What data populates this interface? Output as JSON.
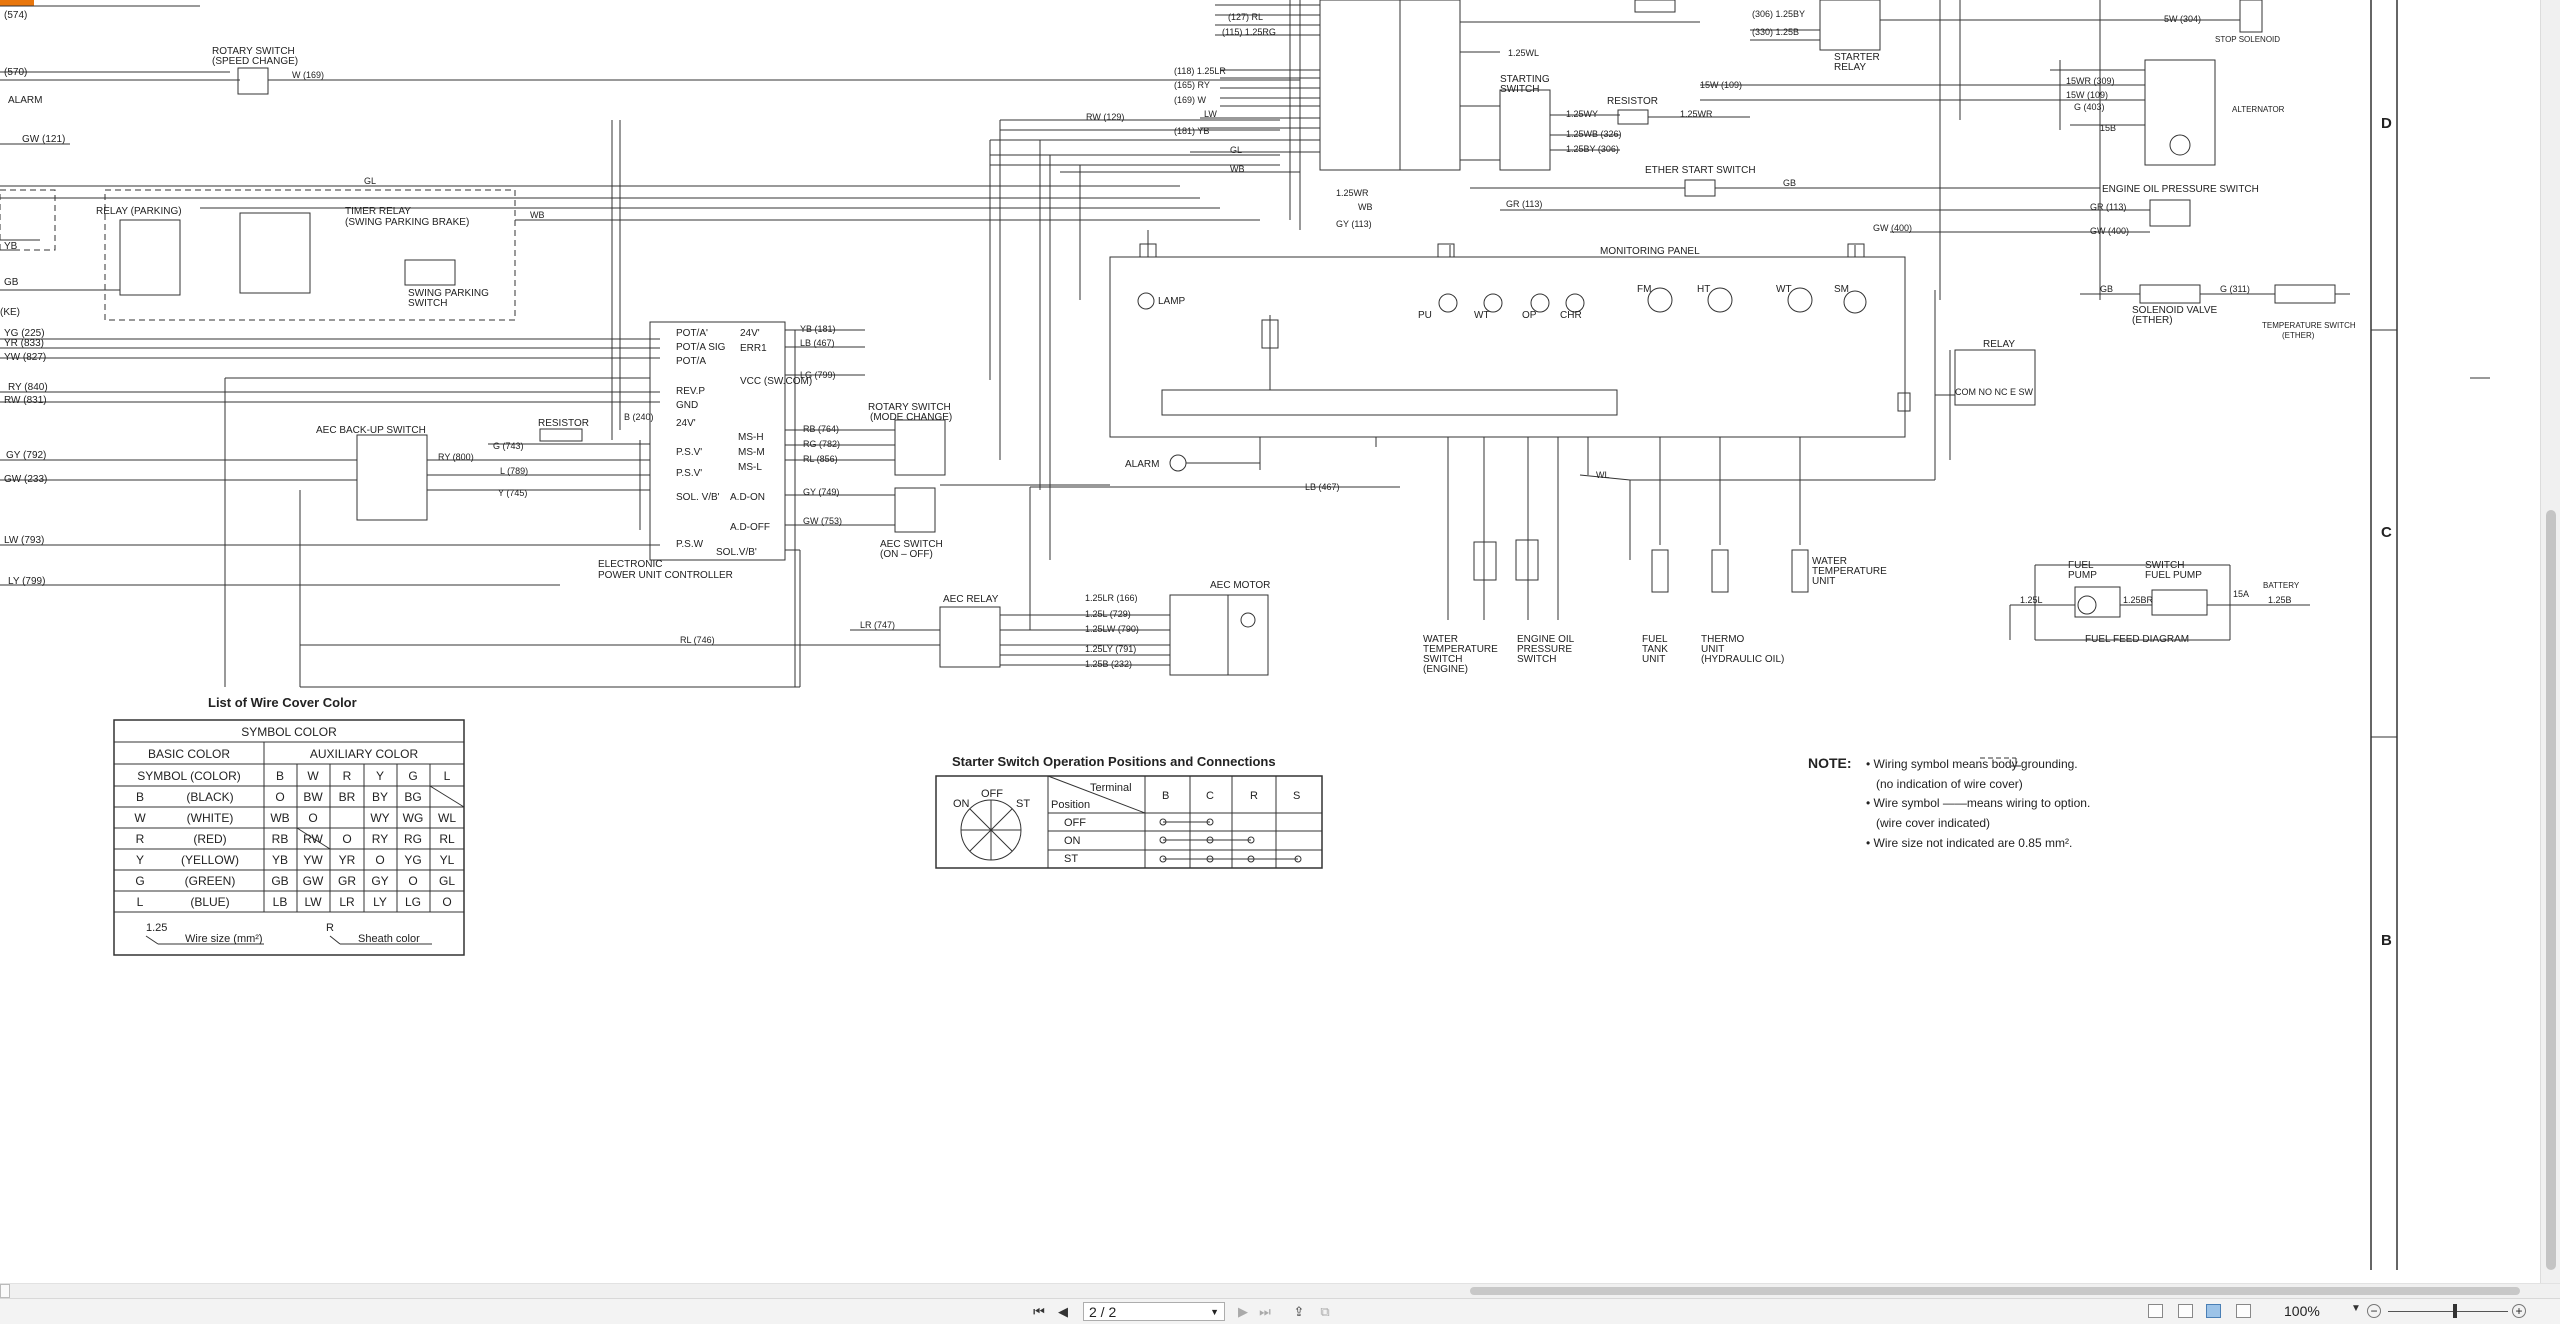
{
  "document": {
    "grid_labels": [
      "D",
      "C",
      "B"
    ],
    "components": {
      "rotary_switch_speed": [
        "ROTARY SWITCH",
        "(SPEED CHANGE)"
      ],
      "alarm": "ALARM",
      "relay_parking": "RELAY (PARKING)",
      "timer_relay": [
        "TIMER RELAY",
        "(SWING PARKING BRAKE)"
      ],
      "swing_parking_switch": [
        "SWING PARKING",
        "SWITCH"
      ],
      "starting_switch": [
        "STARTING",
        "SWITCH"
      ],
      "resistor_top": "RESISTOR",
      "starter_relay": [
        "STARTER",
        "RELAY"
      ],
      "stop_solenoid": "STOP SOLENOID",
      "alternator": "ALTERNATOR",
      "ether_start_switch": "ETHER START SWITCH",
      "engine_oil_pressure_switch": "ENGINE OIL PRESSURE SWITCH",
      "monitoring_panel": "MONITORING PANEL",
      "lamp": "LAMP",
      "solenoid_valve": [
        "SOLENOID VALVE",
        "(ETHER)"
      ],
      "temperature_switch": [
        "TEMPERATURE SWITCH",
        "(ETHER)"
      ],
      "relay_right": "RELAY",
      "relay_terms": "COM NO NC E SW",
      "aec_backup_switch": "AEC BACK-UP SWITCH",
      "resistor_mid": "RESISTOR",
      "controller": [
        "ELECTRONIC",
        "POWER UNIT CONTROLLER"
      ],
      "rotary_switch_mode": [
        "ROTARY SWITCH",
        "(MODE CHANGE)"
      ],
      "aec_switch": [
        "AEC SWITCH",
        "(ON – OFF)"
      ],
      "aec_relay": "AEC RELAY",
      "aec_motor": "AEC MOTOR",
      "alarm_mid": "ALARM",
      "water_temp_switch": [
        "WATER",
        "TEMPERATURE",
        "SWITCH",
        "(ENGINE)"
      ],
      "engine_oil_pressure_sw2": [
        "ENGINE OIL",
        "PRESSURE",
        "SWITCH"
      ],
      "fuel_tank_unit": [
        "FUEL",
        "TANK",
        "UNIT"
      ],
      "thermo_unit": [
        "THERMO",
        "UNIT",
        "(HYDRAULIC OIL)"
      ],
      "water_temp_unit": [
        "WATER",
        "TEMPERATURE",
        "UNIT"
      ],
      "fuel_pump": [
        "FUEL",
        "PUMP"
      ],
      "switch_fuel_pump": [
        "SWITCH",
        "FUEL PUMP"
      ],
      "battery": "BATTERY",
      "fuel_feed_diagram": "FUEL FEED DIAGRAM"
    },
    "controller_pins_left": [
      "POT/A'",
      "POT/A SIG",
      "POT/A",
      "REV.P",
      "GND",
      "24V'",
      "P.S.V'",
      "P.S.V'",
      "SOL. V/B'",
      "P.S.W"
    ],
    "controller_pins_right": [
      "24V'",
      "ERR1",
      "VCC (SW.COM)",
      "MS-H",
      "MS-M",
      "MS-L",
      "A.D-ON",
      "A.D-OFF",
      "SOL.V/B'"
    ],
    "monitor_gauges": [
      "PU",
      "WT",
      "OP",
      "CHR",
      "FM",
      "HT",
      "WT",
      "SM"
    ],
    "wire_labels_left": [
      "(574)",
      "(570)",
      "GW (121)",
      "YB",
      "GB",
      "(KE)",
      "YG (225)",
      "YR (833)",
      "YW (827)",
      "RY (840)",
      "RW (831)",
      "GY (792)",
      "GW (233)",
      "LW (793)",
      "LY (799)"
    ],
    "wire_labels_misc": [
      "W (169)",
      "GL",
      "WB",
      "RW (129)",
      "LW",
      "GL",
      "WB",
      "(181) YB",
      "(165) RY",
      "(169) W",
      "(118) 1.25LR",
      "(127) RL",
      "(115) 1.25RG",
      "1.25WL",
      "1.25WR",
      "1.25WB (326)",
      "1.25BY (306)",
      "1.25WY",
      "GB",
      "GR (113)",
      "GW (400)",
      "GY (113)",
      "1.25WR",
      "WB",
      "RY (800)",
      "L (789)",
      "Y (745)",
      "G (743)",
      "B (240)",
      "YB (181)",
      "LB (467)",
      "LG (799)",
      "RB (764)",
      "RG (782)",
      "RL (856)",
      "GY (749)",
      "GW (753)",
      "LR (747)",
      "RL (746)",
      "LB (467)",
      "WL",
      "1.25LR (166)",
      "1.25L (729)",
      "1.25LW (790)",
      "1.25LY (791)",
      "1.25B (232)",
      "15W (109)",
      "5W (304)",
      "15WR (309)",
      "15W (109)",
      "G (403)",
      "15B",
      "GR (113)",
      "GW (400)",
      "G (311)",
      "GB",
      "1.25L",
      "1.25BR",
      "15A",
      "1.25B",
      "(306) 1.25BY",
      "(330) 1.25B"
    ],
    "wire_cover": {
      "title": "List of Wire Cover Color",
      "symbol_color": "SYMBOL  COLOR",
      "basic_color": "BASIC  COLOR",
      "auxiliary_color": "AUXILIARY  COLOR",
      "header_row": [
        "SYMBOL  (COLOR)",
        "B",
        "W",
        "R",
        "Y",
        "G",
        "L"
      ],
      "rows": [
        [
          "B",
          "(BLACK)",
          "O",
          "BW",
          "BR",
          "BY",
          "BG",
          ""
        ],
        [
          "W",
          "(WHITE)",
          "WB",
          "O",
          "",
          "WY",
          "WG",
          "WL"
        ],
        [
          "R",
          "(RED)",
          "RB",
          "RW",
          "O",
          "RY",
          "RG",
          "RL"
        ],
        [
          "Y",
          "(YELLOW)",
          "YB",
          "YW",
          "YR",
          "O",
          "YG",
          "YL"
        ],
        [
          "G",
          "(GREEN)",
          "GB",
          "GW",
          "GR",
          "GY",
          "O",
          "GL"
        ],
        [
          "L",
          "(BLUE)",
          "LB",
          "LW",
          "LR",
          "LY",
          "LG",
          "O"
        ]
      ],
      "foot_wire_num": "1.25",
      "foot_wire_text": "Wire size (mm²)",
      "foot_sheath_sym": "R",
      "foot_sheath_text": "Sheath color"
    },
    "starter": {
      "title": "Starter Switch Operation Positions and Connections",
      "off": "OFF",
      "on": "ON",
      "st": "ST",
      "terminal": "Terminal",
      "position": "Position",
      "cols": [
        "B",
        "C",
        "R",
        "S"
      ],
      "rows": [
        "OFF",
        "ON",
        "ST"
      ]
    },
    "note": {
      "label": "NOTE:",
      "lines": [
        "• Wiring symbol        means body grounding.",
        "(no indication of wire cover)",
        "• Wire symbol ——means wiring to option.",
        "(wire cover indicated)",
        "• Wire size not indicated are 0.85 mm²."
      ]
    }
  },
  "statusbar": {
    "page_value": "2 / 2",
    "zoom": "100%"
  }
}
